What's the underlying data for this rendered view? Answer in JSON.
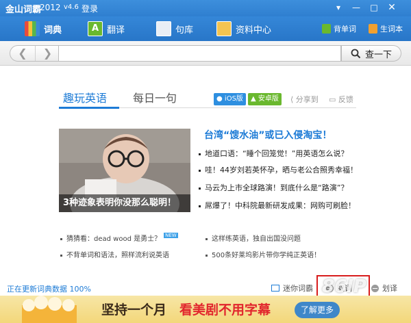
{
  "title_bar": {
    "app_name": "金山词霸",
    "year": "2012",
    "version": "v4.6",
    "login_label": "登录",
    "icons": [
      "dropdown-icon",
      "minimize-icon",
      "maximize-icon",
      "close-icon"
    ]
  },
  "nav": {
    "items": [
      {
        "label": "词典",
        "icon": "dictionary-icon",
        "active": true
      },
      {
        "label": "翻译",
        "icon": "translate-icon",
        "active": false
      },
      {
        "label": "句库",
        "icon": "sentence-library-icon",
        "active": false
      },
      {
        "label": "资料中心",
        "icon": "folder-icon",
        "active": false
      }
    ],
    "right_items": [
      {
        "label": "背单词",
        "icon": "word-card-icon"
      },
      {
        "label": "生词本",
        "icon": "vocab-book-icon"
      }
    ]
  },
  "search": {
    "value": "",
    "button_label": "查一下",
    "icons": [
      "back-arrow-icon",
      "forward-arrow-icon",
      "search-icon"
    ]
  },
  "content": {
    "tabs": [
      {
        "label": "趣玩英语",
        "active": true
      },
      {
        "label": "每日一句",
        "active": false
      }
    ],
    "platforms": {
      "ios": "iOS版",
      "android": "安卓版"
    },
    "share_label": "分享到",
    "feedback_label": "反馈",
    "photo_caption": "3种迹象表明你没那么聪明！",
    "headline": "台湾“馊水油”或已入侵淘宝！",
    "news": [
      "地道口语：“睡个回笼觉！”用英语怎么说？",
      "哇！44岁刘若英怀孕，晒与老公合照秀幸福！",
      "马云为上市全球路演！到底什么是“路演”？",
      "屌爆了！中科院最新研发成果：网购可刷脸！"
    ],
    "bottom_links_left": [
      {
        "text": "猜猜看：dead wood 是勇士？",
        "tag": "NEW"
      },
      {
        "text": "不背单词和语法，照样流利说英语",
        "tag": ""
      }
    ],
    "bottom_links_right": [
      "这样练英语，独自出国没问题",
      "500条好莱坞影片带你学纯正英语！"
    ]
  },
  "status_bar": {
    "status_text": "正在更新词典数据 100%",
    "mini_dict_label": "迷你词霸",
    "take_word_label": "取词",
    "translate_word_label": "划译"
  },
  "banner": {
    "text_part1": "坚持一个月",
    "text_part2": "看美剧不用字幕",
    "cta_label": "了解更多"
  },
  "watermark": "86IP",
  "colors": {
    "brand_blue": "#2f7fd0",
    "link_blue": "#1d7bd6",
    "highlight_red": "#d81c1c",
    "ios_blue": "#2e8fe0",
    "android_green": "#6ab82e"
  }
}
